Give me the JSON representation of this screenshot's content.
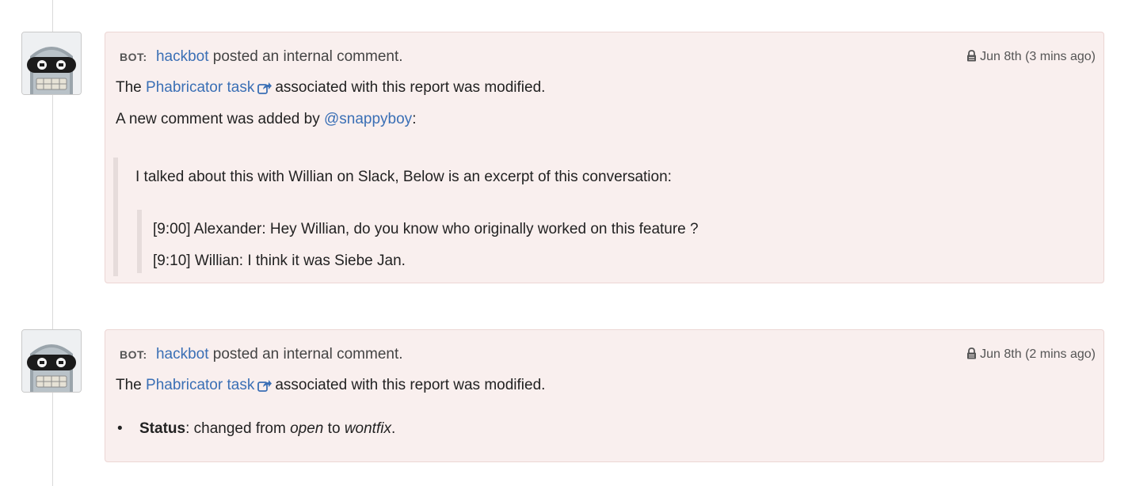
{
  "entries": [
    {
      "bot_label": "BOT:",
      "user": "hackbot",
      "action": "posted an internal comment.",
      "timestamp": "Jun 8th (3 mins ago)",
      "line1_prefix": "The",
      "task_link": "Phabricator task",
      "line1_suffix": "associated with this report was modified.",
      "line2_prefix": "A new comment was added by",
      "mention": "@snappyboy",
      "line2_suffix": ":",
      "quote_text": "I talked about this with Willian on Slack, Below is an excerpt of this conversation:",
      "nested_quote": [
        "[9:00] Alexander: Hey Willian, do you know who originally worked on this feature ?",
        "[9:10] Willian: I think it was Siebe Jan."
      ]
    },
    {
      "bot_label": "BOT:",
      "user": "hackbot",
      "action": "posted an internal comment.",
      "timestamp": "Jun 8th (2 mins ago)",
      "line1_prefix": "The",
      "task_link": "Phabricator task",
      "line1_suffix": "associated with this report was modified.",
      "status_label": "Status",
      "status_text_before": ": changed from",
      "status_from": "open",
      "status_text_mid": "to",
      "status_to": "wontfix",
      "status_end": "."
    }
  ],
  "icons": {
    "avatar": "robot-avatar-icon",
    "lock": "lock-icon",
    "external": "external-link-icon"
  },
  "colors": {
    "link": "#3a6fb5",
    "card_bg": "#f9efee",
    "card_border": "#ecd6d4"
  }
}
